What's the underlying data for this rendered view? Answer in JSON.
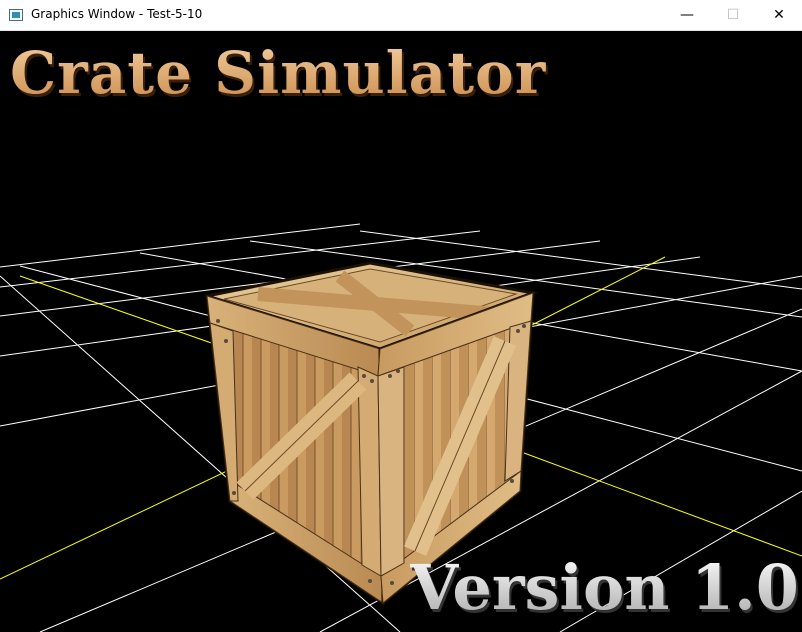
{
  "window": {
    "title": "Graphics Window - Test-5-10",
    "minimize_label": "—",
    "maximize_label": "☐",
    "close_label": "✕"
  },
  "scene": {
    "heading": "Crate Simulator",
    "version": "Version 1.0",
    "colors": {
      "background": "#000000",
      "grid": "#ffffff",
      "axis": "#ffff00",
      "wood_light": "#e8c992",
      "wood_mid": "#c9a068",
      "wood_dark": "#8a6438",
      "edge": "#111111"
    }
  }
}
